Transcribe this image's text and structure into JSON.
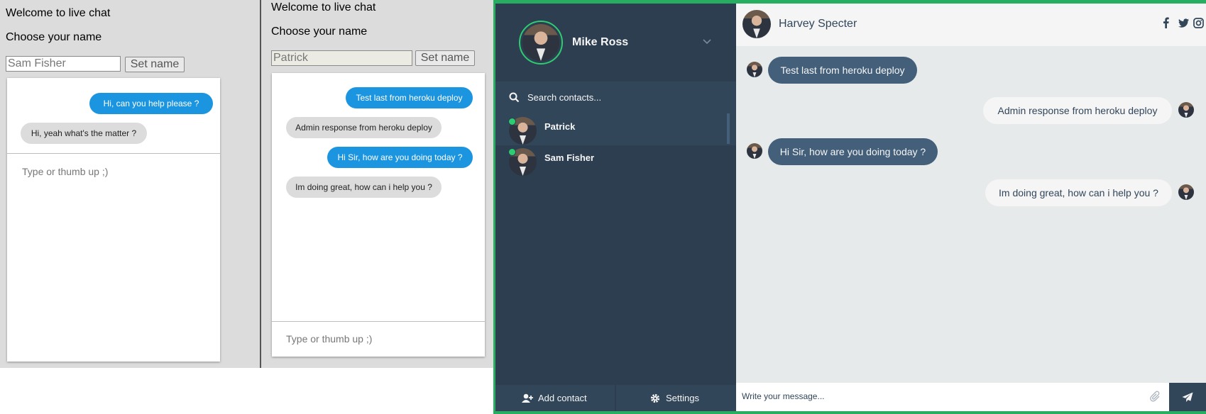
{
  "client_left": {
    "welcome": "Welcome to live chat",
    "choose": "Choose your name",
    "name_value": "Sam Fisher",
    "set_button": "Set name",
    "messages": [
      {
        "text": "Hi, can you help please ?",
        "side": "blue"
      },
      {
        "text": "Hi, yeah what's the matter ?",
        "side": "grey"
      }
    ],
    "input_placeholder": "Type or thumb up ;)"
  },
  "client_right": {
    "welcome": "Welcome to live chat",
    "choose": "Choose your name",
    "name_value": "Patrick",
    "set_button": "Set name",
    "messages": [
      {
        "text": "Test last from heroku deploy",
        "side": "blue"
      },
      {
        "text": "Admin response from heroku deploy",
        "side": "grey"
      },
      {
        "text": "Hi Sir, how are you doing today ?",
        "side": "blue"
      },
      {
        "text": "Im doing great, how can i help you ?",
        "side": "grey"
      }
    ],
    "input_placeholder": "Type or thumb up ;)"
  },
  "admin": {
    "profile_name": "Mike Ross",
    "search_placeholder": "Search contacts...",
    "contacts": [
      {
        "name": "Patrick",
        "status": "online",
        "active": true
      },
      {
        "name": "Sam Fisher",
        "status": "online",
        "active": false
      }
    ],
    "add_contact": "Add contact",
    "settings": "Settings",
    "chat_header_name": "Harvey Specter",
    "social_icons": [
      "facebook-icon",
      "twitter-icon",
      "instagram-icon"
    ],
    "messages": [
      {
        "text": "Test last from heroku deploy",
        "type": "sent"
      },
      {
        "text": "Admin response from heroku deploy",
        "type": "replies"
      },
      {
        "text": "Hi Sir, how are you doing today ?",
        "type": "sent"
      },
      {
        "text": "Im doing great, how can i help you ?",
        "type": "replies"
      }
    ],
    "message_placeholder": "Write your message...",
    "colors": {
      "frame_accent": "#27ae60",
      "sidepanel": "#2c3e50",
      "sent_bubble": "#435f7a",
      "client_blue": "#1b95e0",
      "online": "#2ecc71"
    }
  }
}
